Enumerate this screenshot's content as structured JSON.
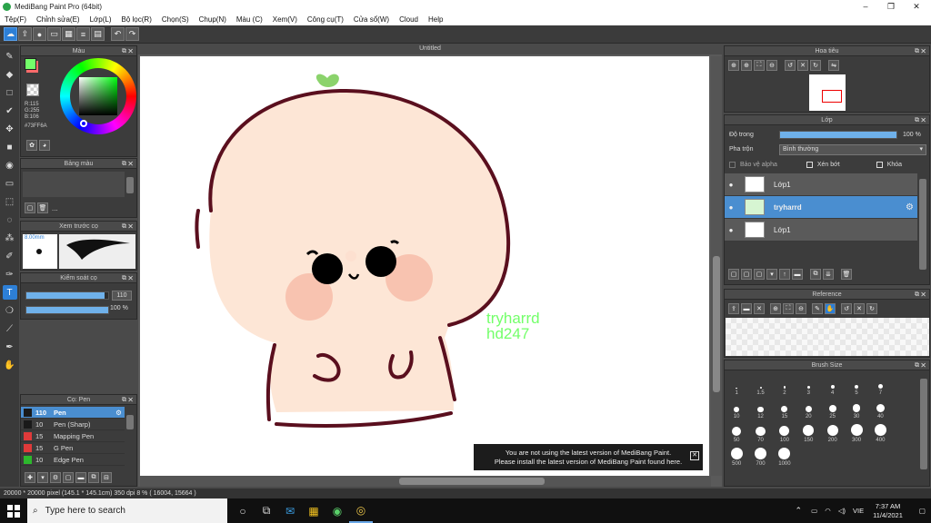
{
  "window": {
    "title": "MediBang Paint Pro (64bit)",
    "minimize": "–",
    "maximize": "❐",
    "close": "✕"
  },
  "menu": [
    "Tệp(F)",
    "Chỉnh sửa(E)",
    "Lớp(L)",
    "Bộ lọc(R)",
    "Chọn(S)",
    "Chụp(N)",
    "Màu (C)",
    "Xem(V)",
    "Công cụ(T)",
    "Cửa sổ(W)",
    "Cloud",
    "Help"
  ],
  "color_panel": {
    "title": "Màu",
    "r": "R:115",
    "g": "G:255",
    "b": "B:106",
    "hex": "#73FF6A",
    "fg_color": "#73ff6a",
    "bg_color": "#ff6b6b"
  },
  "palette_panel": {
    "title": "Bảng màu",
    "more": "..."
  },
  "brush_preview": {
    "title": "Xem trước cọ",
    "size": "8.00mm"
  },
  "brush_control": {
    "title": "Kiểm soát cọ",
    "size_value": "110",
    "opacity_value": "100 %",
    "size_fraction": 0.95,
    "opacity_fraction": 1.0
  },
  "brushes": {
    "title": "Cọ: Pen",
    "items": [
      {
        "size": "110",
        "name": "Pen",
        "color": "#1a1a1a",
        "selected": true
      },
      {
        "size": "10",
        "name": "Pen (Sharp)",
        "color": "#1a1a1a",
        "selected": false
      },
      {
        "size": "15",
        "name": "Mapping Pen",
        "color": "#e03a3a",
        "selected": false
      },
      {
        "size": "15",
        "name": "G Pen",
        "color": "#e03a3a",
        "selected": false
      },
      {
        "size": "10",
        "name": "Edge Pen",
        "color": "#2db82d",
        "selected": false
      }
    ]
  },
  "canvas": {
    "tab_title": "Untitled",
    "watermark_line1": "tryharrd",
    "watermark_line2": "hd247"
  },
  "notice": {
    "line1": "You are not using the latest version of MediBang Paint.",
    "line2": "Please install the latest version of MediBang Paint found here.",
    "close": "✕"
  },
  "status": "20000 * 20000 pixel  (145.1 * 145.1cm)  350 dpi  8 %  ( 16004, 15664 )",
  "navigator": {
    "title": "Hoa tiêu"
  },
  "layer_panel": {
    "title": "Lớp",
    "opacity_label": "Độ trong",
    "opacity_value": "100 %",
    "opacity_fraction": 1.0,
    "blend_label": "Pha trộn",
    "blend_value": "Bình thường",
    "protect_alpha": "Bảo vệ alpha",
    "clipping": "Xén bớt",
    "lock": "Khóa",
    "layers": [
      {
        "name": "Lớp1",
        "selected": false
      },
      {
        "name": "tryharrd",
        "selected": true
      },
      {
        "name": "Lớp1",
        "selected": false
      }
    ]
  },
  "reference": {
    "title": "Reference"
  },
  "brush_size": {
    "title": "Brush Size",
    "sizes": [
      "1",
      "1.5",
      "2",
      "3",
      "4",
      "5",
      "7",
      "10",
      "12",
      "15",
      "20",
      "25",
      "30",
      "40",
      "50",
      "70",
      "100",
      "150",
      "200",
      "300",
      "400",
      "500",
      "700",
      "1000"
    ]
  },
  "taskbar": {
    "search_placeholder": "Type here to search",
    "lang": "VIE",
    "time": "7:37 AM",
    "date": "11/4/2021"
  }
}
